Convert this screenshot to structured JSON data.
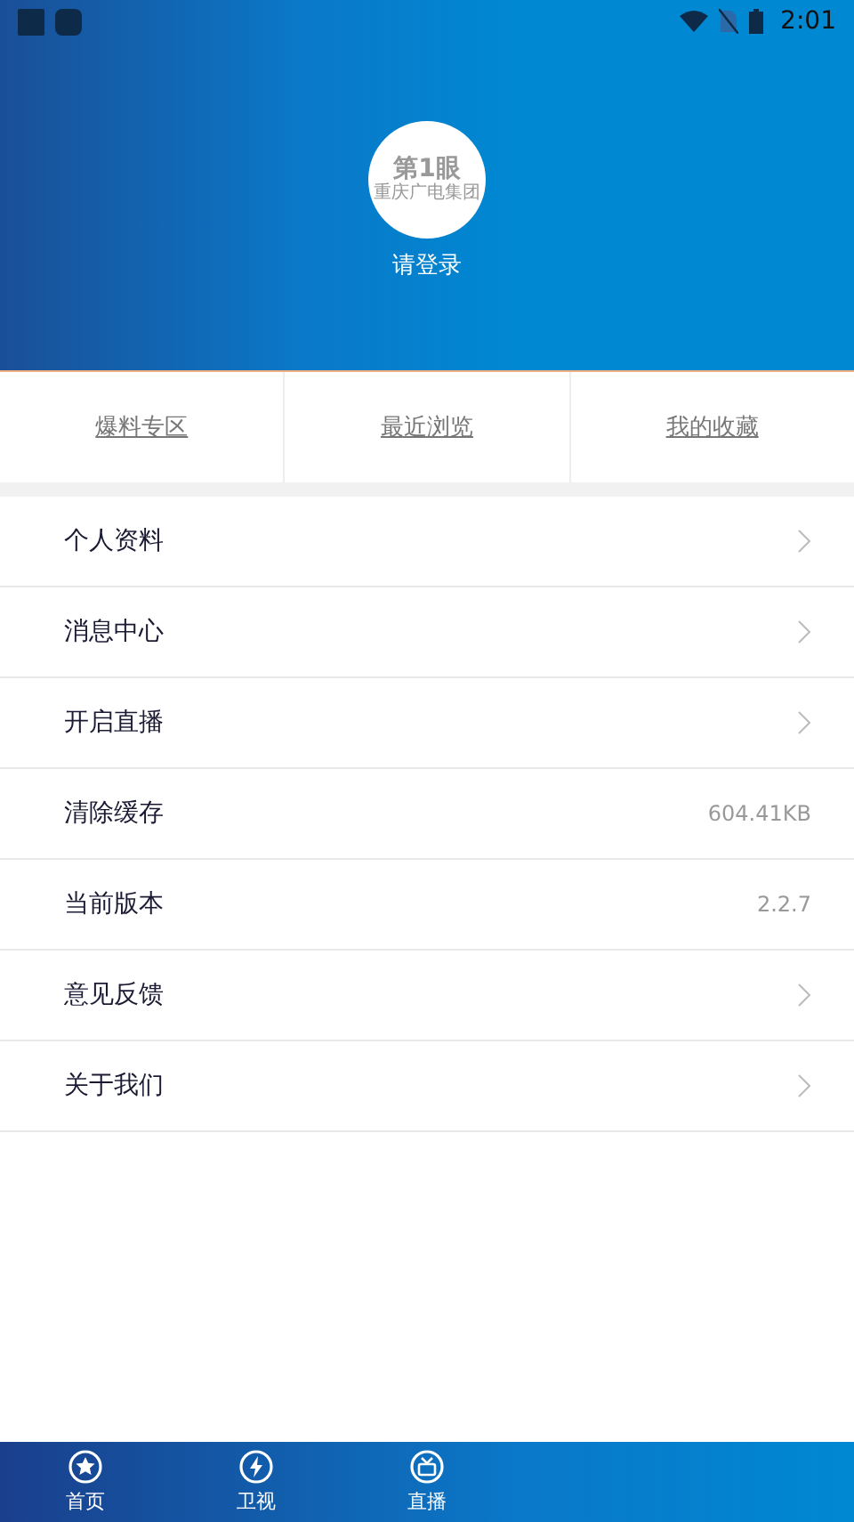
{
  "status_bar": {
    "time": "2:01"
  },
  "profile": {
    "logo_title": "第1眼",
    "logo_subtitle": "重庆广电集团",
    "login": "请登录"
  },
  "shortcuts": [
    "爆料专区",
    "最近浏览",
    "我的收藏"
  ],
  "settings": [
    {
      "label": "个人资料",
      "kind": "link"
    },
    {
      "label": "消息中心",
      "kind": "link"
    },
    {
      "label": "开启直播",
      "kind": "link"
    },
    {
      "label": "清除缓存",
      "kind": "value",
      "value": "604.41KB"
    },
    {
      "label": "当前版本",
      "kind": "value",
      "value": "2.2.7"
    },
    {
      "label": "意见反馈",
      "kind": "link"
    },
    {
      "label": "关于我们",
      "kind": "link"
    }
  ],
  "tab_bar": [
    {
      "label": "首页",
      "kind": "home"
    },
    {
      "label": "卫视",
      "kind": "channels"
    },
    {
      "label": "直播",
      "kind": "live"
    }
  ]
}
